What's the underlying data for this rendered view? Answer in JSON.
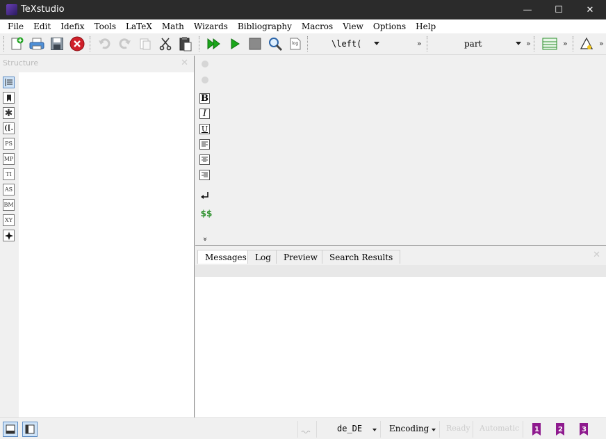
{
  "window": {
    "title": "TeXstudio",
    "minimize": "—",
    "maximize": "☐",
    "close": "✕"
  },
  "menu": [
    "File",
    "Edit",
    "Idefix",
    "Tools",
    "LaTeX",
    "Math",
    "Wizards",
    "Bibliography",
    "Macros",
    "View",
    "Options",
    "Help"
  ],
  "toolbar": {
    "left_combo": "\\left(",
    "section_combo": "part",
    "more": "»"
  },
  "structure": {
    "header": "Structure",
    "close": "✕",
    "side_tabs": [
      "",
      "",
      "✱",
      "([.",
      "PS",
      "MP",
      "TI",
      "AS",
      "BM",
      "XY",
      ""
    ]
  },
  "editor_toolbar": {
    "bold": "B",
    "italic": "I",
    "underline": "U",
    "math": "$$",
    "more": "»"
  },
  "bottom_panel": {
    "tabs": [
      "Messages",
      "Log",
      "Preview",
      "Search Results"
    ],
    "close": "✕"
  },
  "status": {
    "language": "de_DE",
    "encoding": "Encoding",
    "ready": "Ready",
    "automatic": "Automatic",
    "bookmarks": [
      "1",
      "2",
      "3"
    ]
  },
  "colors": {
    "titlebar": "#2b2b2b",
    "accent": "#5a8ac2",
    "compile_green": "#1aa61a",
    "bookmark_purple": "#8e1a8e"
  }
}
